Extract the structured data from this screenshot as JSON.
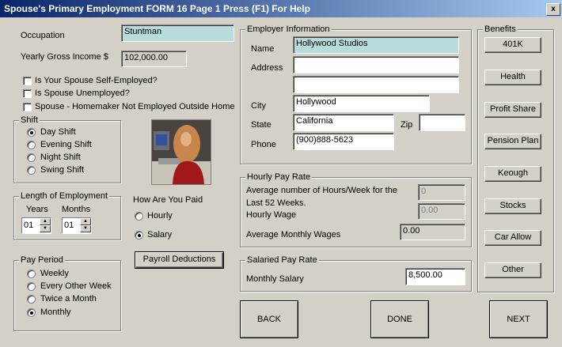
{
  "window": {
    "title": "Spouse's Primary Employment FORM 16   Page 1   Press (F1) For Help",
    "close_glyph": "x"
  },
  "occupation": {
    "label": "Occupation",
    "value": "Stuntman"
  },
  "income": {
    "label": "Yearly Gross Income $",
    "value": "102,000.00"
  },
  "checks": {
    "self_employed": "Is Your Spouse Self-Employed?",
    "unemployed": "Is Spouse Unemployed?",
    "homemaker": "Spouse - Homemaker Not Employed Outside Home"
  },
  "shift": {
    "title": "Shift",
    "options": [
      "Day Shift",
      "Evening Shift",
      "Night Shift",
      "Swing Shift"
    ],
    "selected": "Day Shift"
  },
  "length": {
    "title": "Length of Employment",
    "years_label": "Years",
    "years_value": "01",
    "months_label": "Months",
    "months_value": "01"
  },
  "paid": {
    "title": "How Are You Paid",
    "hourly": "Hourly",
    "salary": "Salary",
    "selected": "Salary"
  },
  "payroll_button": "Payroll Deductions",
  "pay_period": {
    "title": "Pay Period",
    "options": [
      "Weekly",
      "Every Other Week",
      "Twice a Month",
      "Monthly"
    ],
    "selected": "Monthly"
  },
  "employer": {
    "title": "Employer Information",
    "name_label": "Name",
    "name": "Hollywood Studios",
    "address_label": "Address",
    "address1": "",
    "address2": "",
    "city_label": "City",
    "city": "Hollywood",
    "state_label": "State",
    "state": "California",
    "zip_label": "Zip",
    "zip": "",
    "phone_label": "Phone",
    "phone": "(900)888-5623"
  },
  "hourly_rate": {
    "title": "Hourly Pay Rate",
    "hours_label_1": "Average number of Hours/Week for the",
    "hours_label_2": "Last 52 Weeks.",
    "hours_value": "0",
    "wage_label": "Hourly Wage",
    "wage_value": "0.00",
    "monthly_label": "Average Monthly Wages",
    "monthly_value": "0.00"
  },
  "salaried": {
    "title": "Salaried Pay Rate",
    "label": "Monthly Salary",
    "value": "8,500.00"
  },
  "benefits": {
    "title": "Benefits",
    "items": [
      "401K",
      "Health",
      "Profit Share",
      "Pension Plan",
      "Keough",
      "Stocks",
      "Car Allow",
      "Other"
    ]
  },
  "nav": {
    "back": "BACK",
    "done": "DONE",
    "next": "NEXT"
  },
  "photo": {
    "icon": "person-at-computer-photo"
  }
}
